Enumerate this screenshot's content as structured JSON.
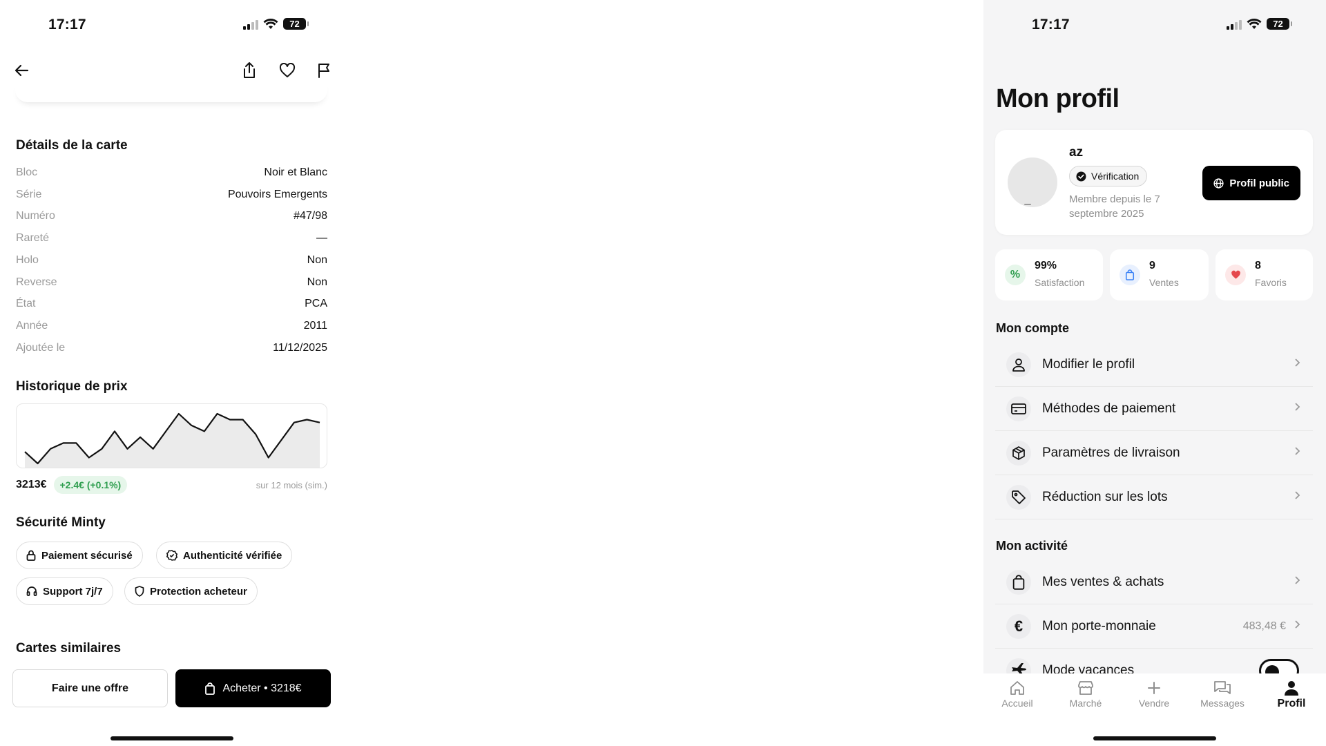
{
  "left_screen": {
    "status": {
      "time": "17:17",
      "battery": "72"
    },
    "details": {
      "title": "Détails de la carte",
      "rows": [
        {
          "key": "Bloc",
          "value": "Noir et Blanc"
        },
        {
          "key": "Série",
          "value": "Pouvoirs Emergents"
        },
        {
          "key": "Numéro",
          "value": "#47/98"
        },
        {
          "key": "Rareté",
          "value": "—"
        },
        {
          "key": "Holo",
          "value": "Non"
        },
        {
          "key": "Reverse",
          "value": "Non"
        },
        {
          "key": "État",
          "value": "PCA"
        },
        {
          "key": "Année",
          "value": "2011"
        },
        {
          "key": "Ajoutée le",
          "value": "11/12/2025"
        }
      ]
    },
    "price_history": {
      "title": "Historique de prix",
      "current": "3213€",
      "change": "+2.4€ (+0.1%)",
      "note": "sur 12 mois (sim.)",
      "chart_data": {
        "type": "area",
        "title": "",
        "xlabel": "",
        "ylabel": "",
        "grid": false,
        "values": [
          3200,
          3196,
          3201,
          3203,
          3203,
          3198,
          3201,
          3207,
          3201,
          3205,
          3201,
          3207,
          3213,
          3209,
          3207,
          3213,
          3211,
          3211,
          3206,
          3198,
          3204,
          3210,
          3211,
          3210
        ]
      }
    },
    "security": {
      "title": "Sécurité Minty",
      "chips": [
        "Paiement sécurisé",
        "Authenticité vérifiée",
        "Support 7j/7",
        "Protection acheteur"
      ]
    },
    "similar": {
      "title": "Cartes similaires"
    },
    "actions": {
      "offer": "Faire une offre",
      "buy": "Acheter • 3218€"
    }
  },
  "right_screen": {
    "status": {
      "time": "17:17",
      "battery": "72"
    },
    "title": "Mon profil",
    "profile": {
      "username": "az",
      "badge": "Vérification",
      "member_since": "Membre depuis le 7 septembre 2025",
      "public_button": "Profil public"
    },
    "stats": [
      {
        "value": "99%",
        "label": "Satisfaction",
        "icon": "percent-icon",
        "color": "#2f9e4f",
        "bg": "#e6f6ea"
      },
      {
        "value": "9",
        "label": "Ventes",
        "icon": "bag-icon",
        "color": "#3b82f6",
        "bg": "#e8f0fe"
      },
      {
        "value": "8",
        "label": "Favoris",
        "icon": "heart-icon",
        "color": "#e5484d",
        "bg": "#fde8e8"
      }
    ],
    "account": {
      "title": "Mon compte",
      "items": [
        {
          "label": "Modifier le profil",
          "icon": "user-icon"
        },
        {
          "label": "Méthodes de paiement",
          "icon": "card-icon"
        },
        {
          "label": "Paramètres de livraison",
          "icon": "box-icon"
        },
        {
          "label": "Réduction sur les lots",
          "icon": "tag-icon"
        }
      ]
    },
    "activity": {
      "title": "Mon activité",
      "items": [
        {
          "label": "Mes ventes & achats",
          "icon": "bag-icon"
        },
        {
          "label": "Mon porte-monnaie",
          "icon": "euro-icon",
          "value": "483,48 €"
        },
        {
          "label": "Mode vacances",
          "icon": "plane-icon"
        }
      ]
    },
    "tabs": [
      {
        "label": "Accueil",
        "icon": "home-icon"
      },
      {
        "label": "Marché",
        "icon": "store-icon"
      },
      {
        "label": "Vendre",
        "icon": "plus-icon"
      },
      {
        "label": "Messages",
        "icon": "messages-icon"
      },
      {
        "label": "Profil",
        "icon": "person-icon",
        "active": true
      }
    ]
  }
}
